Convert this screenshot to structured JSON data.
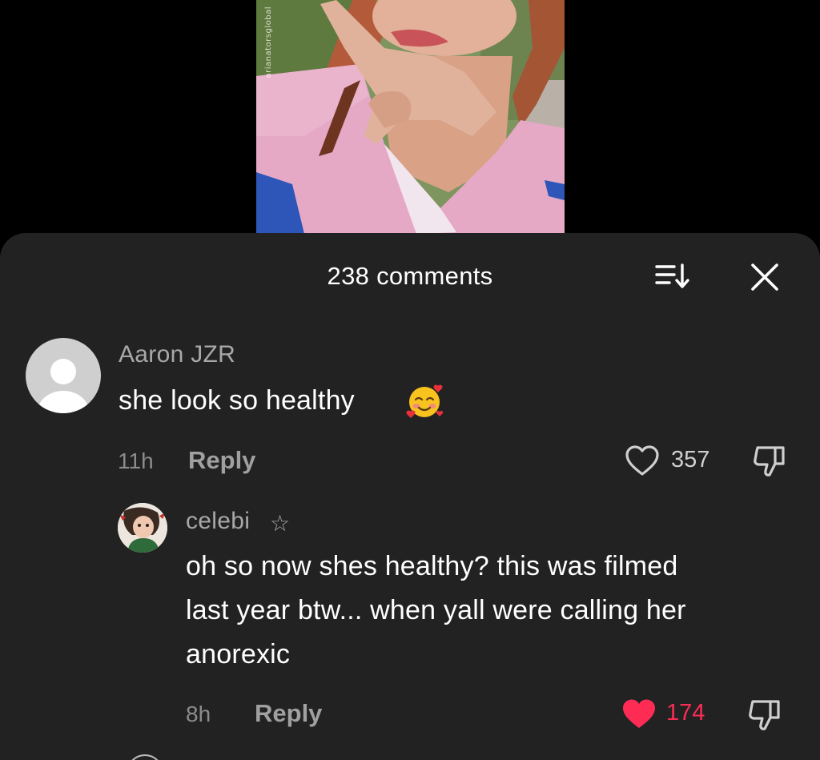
{
  "video": {
    "watermark": "arianatorsglobal"
  },
  "comments_sheet": {
    "title": "238 comments",
    "sort_icon": "sort-icon",
    "close_icon": "close-icon"
  },
  "comments": [
    {
      "username": "Aaron  JZR",
      "text": "she look so healthy",
      "emoji": "smiling-face-with-hearts",
      "time": "11h",
      "reply_label": "Reply",
      "likes": "357",
      "liked": false
    },
    {
      "username": "celebi",
      "badge_icon": "star-outline-icon",
      "text_lines": [
        "oh so now shes healthy? this was filmed",
        "last year btw... when yall were calling her",
        "anorexic"
      ],
      "time": "8h",
      "reply_label": "Reply",
      "likes": "174",
      "liked": true
    }
  ],
  "colors": {
    "sheet_bg": "#222222",
    "liked_red": "#fe2c55",
    "muted_text": "#a8a8a8"
  }
}
